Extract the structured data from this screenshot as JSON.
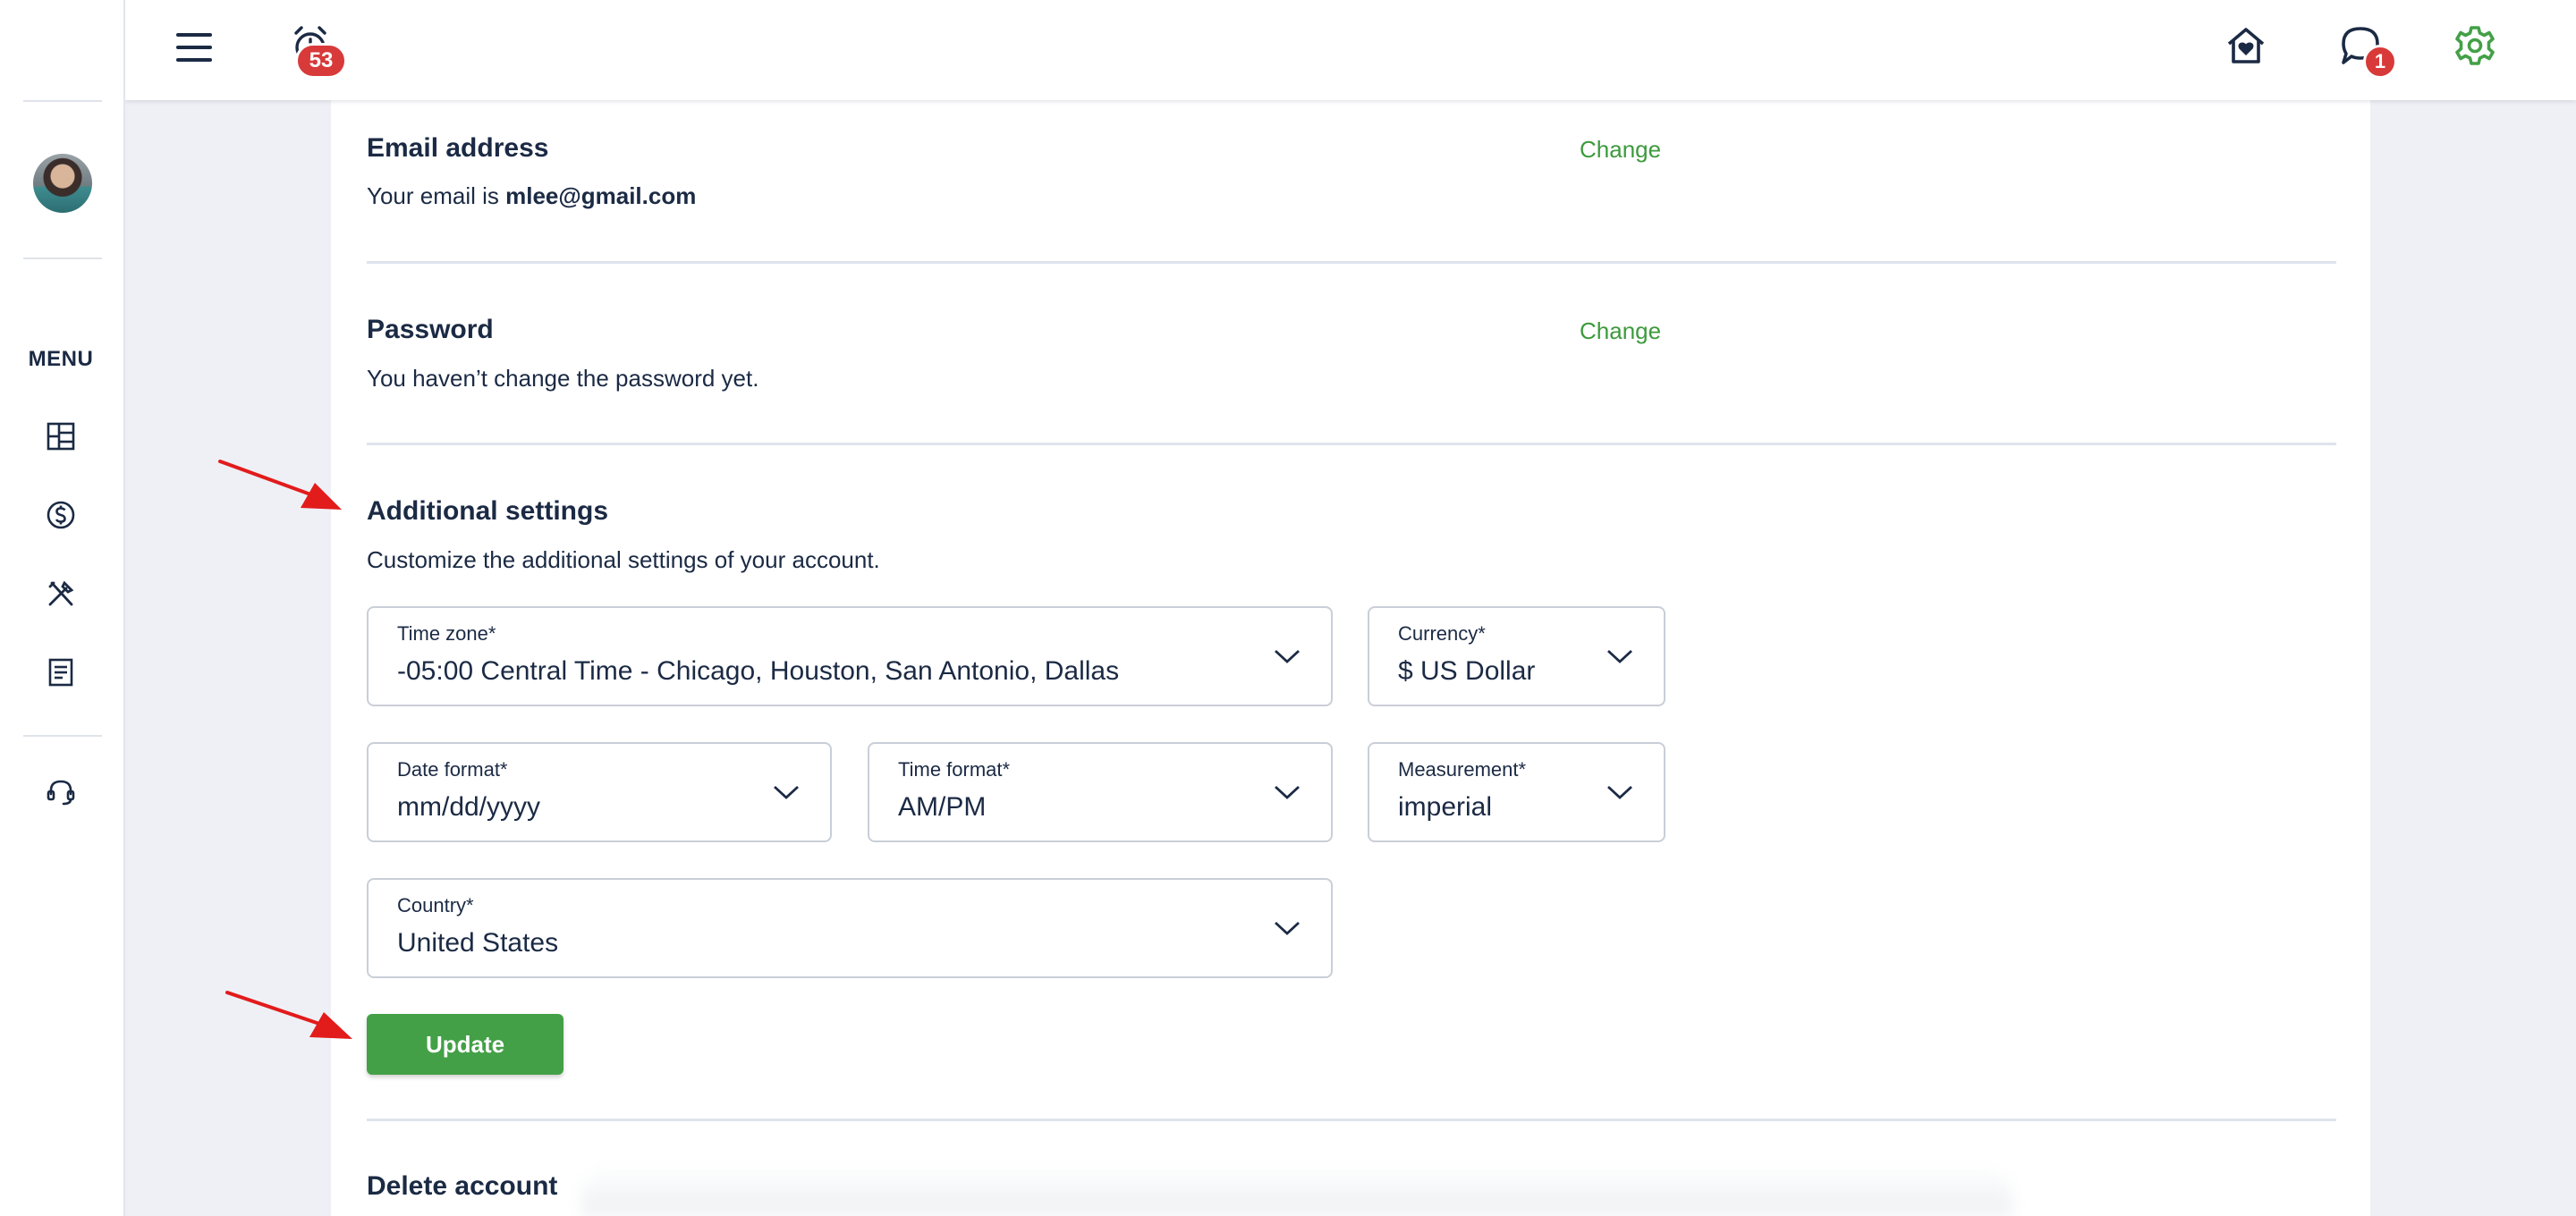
{
  "sidebar": {
    "menu_label": "MENU",
    "icons": [
      "dashboard-icon",
      "dollar-icon",
      "tools-icon",
      "document-icon",
      "support-icon"
    ]
  },
  "topbar": {
    "reminders_badge": "53",
    "messages_badge": "1",
    "icons": [
      "hamburger-menu-icon",
      "alarm-clock-icon",
      "home-heart-icon",
      "chat-bubble-icon",
      "gear-icon"
    ]
  },
  "email": {
    "title": "Email address",
    "prefix": "Your email is ",
    "value": "mlee@gmail.com",
    "change_label": "Change"
  },
  "password": {
    "title": "Password",
    "text": "You haven’t change the password yet.",
    "change_label": "Change"
  },
  "additional": {
    "title": "Additional settings",
    "subtitle": "Customize the additional settings of your account.",
    "fields": {
      "timezone": {
        "label": "Time zone*",
        "value": "-05:00 Central Time - Chicago, Houston, San Antonio, Dallas"
      },
      "currency": {
        "label": "Currency*",
        "value": "$ US Dollar"
      },
      "date_format": {
        "label": "Date format*",
        "value": "mm/dd/yyyy"
      },
      "time_format": {
        "label": "Time format*",
        "value": "AM/PM"
      },
      "measurement": {
        "label": "Measurement*",
        "value": "imperial"
      },
      "country": {
        "label": "Country*",
        "value": "United States"
      }
    },
    "update_label": "Update"
  },
  "delete": {
    "title": "Delete account"
  },
  "colors": {
    "accent_green": "#43a047",
    "link_green": "#3d9a3d",
    "badge_red": "#d83a3a",
    "annotation_red": "#e21b1b",
    "text_navy": "#1b2a44"
  }
}
